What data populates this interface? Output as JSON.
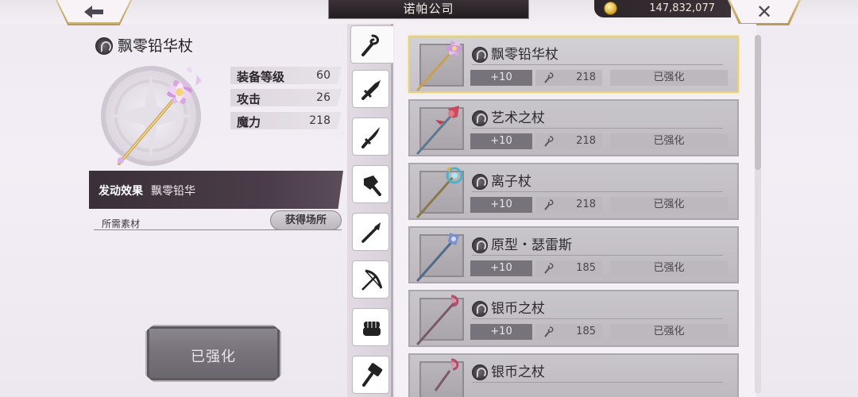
{
  "header": {
    "title": "诺帕公司",
    "currency_amount": "147,832,077",
    "back_symbol": "🡐",
    "close_symbol": "✕"
  },
  "detail": {
    "item_name": "飘零铅华杖",
    "stats": [
      {
        "label": "装备等级",
        "value": "60"
      },
      {
        "label": "攻击",
        "value": "26"
      },
      {
        "label": "魔力",
        "value": "218"
      }
    ],
    "effect_label": "发动效果",
    "effect_value": "飘零铅华",
    "material_label": "所需素材",
    "obtain_button": "获得场所",
    "enhanced_button": "已强化"
  },
  "tabs": [
    {
      "name": "staff",
      "icon": "staff-icon"
    },
    {
      "name": "sword",
      "icon": "sword-icon"
    },
    {
      "name": "dagger",
      "icon": "dagger-icon"
    },
    {
      "name": "axe",
      "icon": "axe-icon"
    },
    {
      "name": "spear",
      "icon": "spear-icon"
    },
    {
      "name": "bow",
      "icon": "bow-icon"
    },
    {
      "name": "knuckle",
      "icon": "fist-icon"
    },
    {
      "name": "hammer",
      "icon": "hammer-icon"
    }
  ],
  "items": [
    {
      "name": "飘零铅华杖",
      "plus": "+10",
      "stat": "218",
      "status": "已强化",
      "selected": true
    },
    {
      "name": "艺术之杖",
      "plus": "+10",
      "stat": "218",
      "status": "已强化",
      "selected": false
    },
    {
      "name": "离子杖",
      "plus": "+10",
      "stat": "218",
      "status": "已强化",
      "selected": false
    },
    {
      "name": "原型・瑟雷斯",
      "plus": "+10",
      "stat": "185",
      "status": "已强化",
      "selected": false
    },
    {
      "name": "银币之杖",
      "plus": "+10",
      "stat": "185",
      "status": "已强化",
      "selected": false
    },
    {
      "name": "银币之杖",
      "plus": "",
      "stat": "",
      "status": "",
      "selected": false
    }
  ],
  "colors": {
    "selected_border": "#e7d27c",
    "gold": "#b79a55",
    "effect_bar": "#3a3039"
  }
}
